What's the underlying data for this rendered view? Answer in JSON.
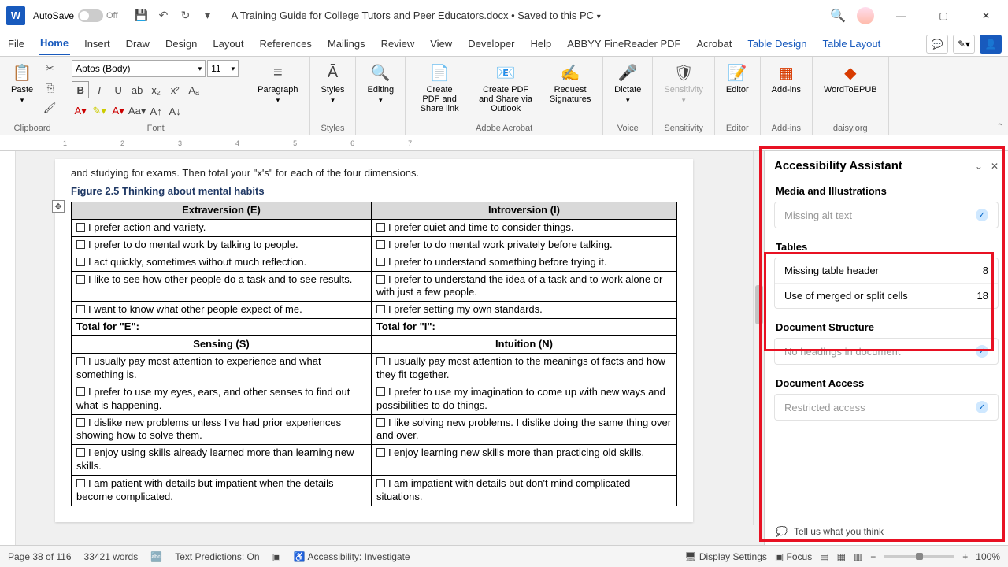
{
  "title_bar": {
    "app_letter": "W",
    "autosave": "AutoSave",
    "autosave_state": "Off",
    "doc_name": "A Training Guide for College Tutors and Peer Educators.docx",
    "save_state": "Saved to this PC"
  },
  "tabs": {
    "file": "File",
    "home": "Home",
    "insert": "Insert",
    "draw": "Draw",
    "design": "Design",
    "layout": "Layout",
    "references": "References",
    "mailings": "Mailings",
    "review": "Review",
    "view": "View",
    "developer": "Developer",
    "help": "Help",
    "abbyy": "ABBYY FineReader PDF",
    "acrobat": "Acrobat",
    "table_design": "Table Design",
    "table_layout": "Table Layout"
  },
  "ribbon": {
    "clipboard": "Clipboard",
    "paste": "Paste",
    "font_group": "Font",
    "font_name": "Aptos (Body)",
    "font_size": "11",
    "paragraph": "Paragraph",
    "styles": "Styles",
    "editing": "Editing",
    "create_pdf": "Create PDF and Share link",
    "create_outlook": "Create PDF and Share via Outlook",
    "request_sig": "Request Signatures",
    "acrobat": "Adobe Acrobat",
    "dictate": "Dictate",
    "voice": "Voice",
    "sensitivity": "Sensitivity",
    "sensitivity_g": "Sensitivity",
    "editor": "Editor",
    "editor_g": "Editor",
    "addins": "Add-ins",
    "addins_g": "Add-ins",
    "wordtoepub": "WordToEPUB",
    "daisy": "daisy.org"
  },
  "document": {
    "trunc_line": "and studying for exams. Then total your \"x's\" for each of the four dimensions.",
    "caption": "Figure 2.5 Thinking about mental habits",
    "h_e": "Extraversion (E)",
    "h_i": "Introversion (I)",
    "r1e": "I prefer action and variety.",
    "r1i": "I prefer quiet and time to consider things.",
    "r2e": "I prefer to do mental work by talking to people.",
    "r2i": "I prefer to do mental work privately before talking.",
    "r3e": "I act quickly, sometimes without much reflection.",
    "r3i": "I prefer to understand something before trying it.",
    "r4e": "I like to see how other people do a task and to see results.",
    "r4i": "I prefer to understand the idea of a task and to work alone or with just a few people.",
    "r5e": "I want to know what other people expect of me.",
    "r5i": "I prefer setting my own standards.",
    "tote": "Total for \"E\":",
    "toti": "Total for \"I\":",
    "h_s": "Sensing (S)",
    "h_n": "Intuition (N)",
    "s1": "I usually pay most attention to experience and what something is.",
    "n1": "I usually pay most attention to the meanings of facts and how they fit together.",
    "s2": "I prefer to use my eyes, ears, and other senses to find out what is happening.",
    "n2": "I prefer to use my imagination to come up with new ways and possibilities to do things.",
    "s3": "I dislike new problems unless I've had prior experiences showing how to solve them.",
    "n3": "I like solving new problems. I dislike doing the same thing over and over.",
    "s4": "I enjoy using skills already learned more than learning new skills.",
    "n4": "I enjoy learning new skills more than practicing old skills.",
    "s5": "I am patient with details but impatient when the details become complicated.",
    "n5": "I am impatient with details but don't mind complicated situations."
  },
  "ruler_marks": [
    "1",
    "2",
    "3",
    "4",
    "5",
    "6",
    "7"
  ],
  "panel": {
    "title": "Accessibility Assistant",
    "sec_media": "Media and Illustrations",
    "alt_text": "Missing alt text",
    "sec_tables": "Tables",
    "missing_header": "Missing table header",
    "missing_header_n": "8",
    "merged": "Use of merged or split cells",
    "merged_n": "18",
    "sec_struct": "Document Structure",
    "no_headings": "No headings in document",
    "sec_access": "Document Access",
    "restricted": "Restricted access",
    "tell_us": "Tell us what you think"
  },
  "status": {
    "page": "Page 38 of 116",
    "words": "33421 words",
    "predictions": "Text Predictions: On",
    "accessibility": "Accessibility: Investigate",
    "display": "Display Settings",
    "focus": "Focus",
    "zoom": "100%"
  }
}
